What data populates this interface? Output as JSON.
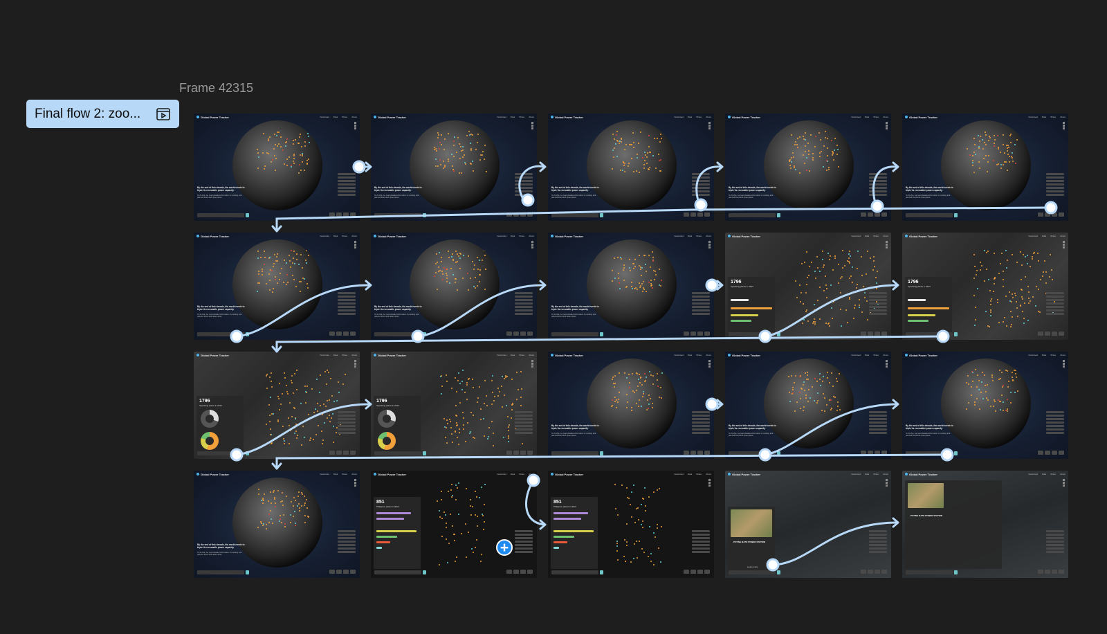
{
  "frame": {
    "title": "Frame 42315"
  },
  "flow": {
    "label": "Final flow 2: zoo...",
    "icon": "flow-play-icon"
  },
  "thumbnail": {
    "brand": "Global Power Tracker",
    "nav": [
      "Download",
      "Data",
      "Share",
      "About"
    ],
    "caption_heading": "By the end of this decade, the world needs to triple its renewable power capacity.",
    "caption_body": "To do that, we need detailed information on existing and planned fossil and clean plants."
  },
  "panels": {
    "china_count": "1796",
    "china_sub": "Operating plants in 2023",
    "ph_count": "851",
    "ph_sub": "Philippine plants in 2024",
    "station_title": "PUTING BATO POWER STATION",
    "station_link": "Learn more"
  },
  "colors": {
    "accent": "#b8d8f7",
    "connector": "#b8d8f7",
    "plant": "#f2a03a",
    "clean": "#5fd3d9"
  }
}
